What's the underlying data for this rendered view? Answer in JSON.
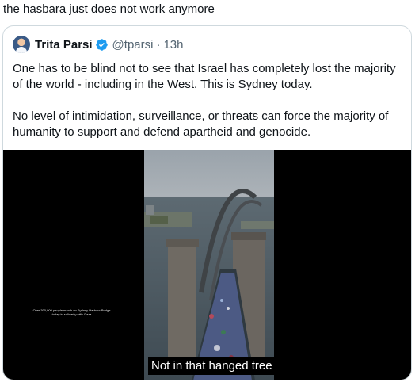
{
  "post": {
    "text": "the hasbara just does not work anymore"
  },
  "quote": {
    "author_name": "Trita Parsi",
    "handle": "@tparsi",
    "separator": "·",
    "time": "13h",
    "paragraphs": [
      "One has to be blind not to see that Israel has completely lost the majority of the world - including in the West. This is Sydney today.",
      "No level of intimidation, surveillance, or threats can force the majority of humanity to support and defend apartheid and genocide."
    ],
    "icons": {
      "avatar": "avatar-image",
      "verified": "verified-badge-icon"
    },
    "colors": {
      "verified": "#1d9bf0",
      "secondary_text": "#536471",
      "border": "#cfd9de"
    }
  },
  "media": {
    "overlay_caption": "Over 300,000 people march on Sydney Harbour Bridge today in solidarity with Gaza",
    "subtitle": "Not in that hanged tree"
  }
}
